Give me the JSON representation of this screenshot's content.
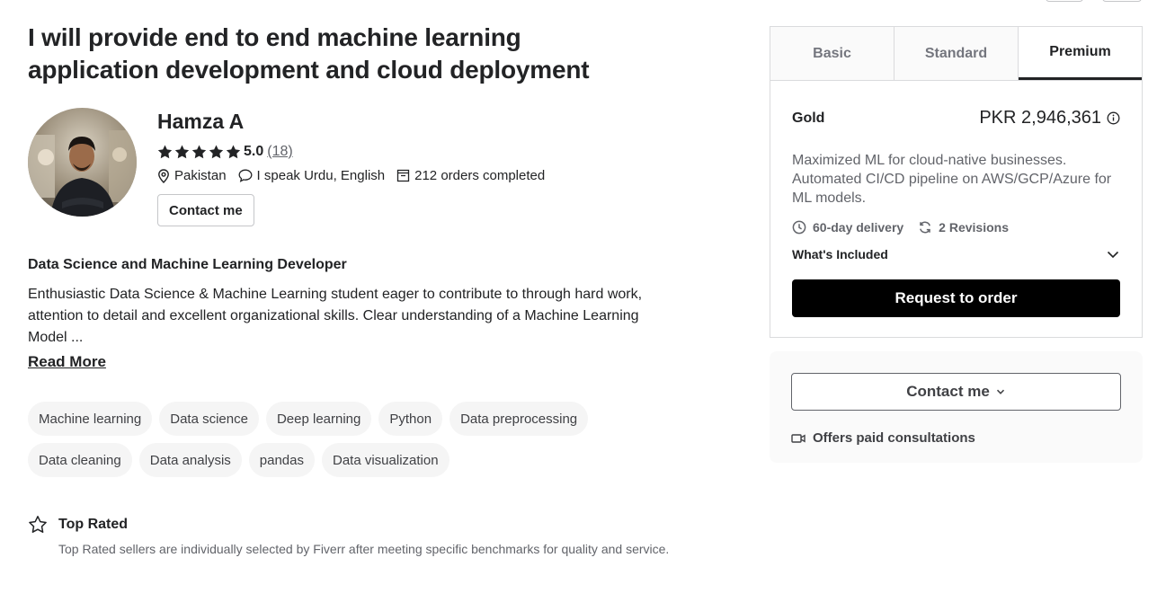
{
  "gig": {
    "title": "I will provide end to end machine learning application development and cloud deployment"
  },
  "seller": {
    "name": "Hamza A",
    "rating": "5.0",
    "reviews": "(18)",
    "stars": 5,
    "country": "Pakistan",
    "languages": "I speak Urdu, English",
    "orders": "212 orders completed",
    "contact_label": "Contact me"
  },
  "about": {
    "heading": "Data Science and Machine Learning Developer",
    "text": "Enthusiastic Data Science & Machine Learning student eager to contribute to through hard work, attention to detail and excellent organizational skills. Clear understanding of a Machine Learning Model ...",
    "read_more": "Read More"
  },
  "tags": [
    "Machine learning",
    "Data science",
    "Deep learning",
    "Python",
    "Data preprocessing",
    "Data cleaning",
    "Data analysis",
    "pandas",
    "Data visualization"
  ],
  "top_rated": {
    "title": "Top Rated",
    "description": "Top Rated sellers are individually selected by Fiverr after meeting specific benchmarks for quality and service."
  },
  "packages": {
    "tabs": [
      "Basic",
      "Standard",
      "Premium"
    ],
    "active_tab": "Premium",
    "name": "Gold",
    "price": "PKR 2,946,361",
    "description": "Maximized ML for cloud-native businesses. Automated CI/CD pipeline on AWS/GCP/Azure for ML models.",
    "delivery": "60-day delivery",
    "revisions": "2 Revisions",
    "included_label": "What's Included",
    "order_label": "Request to order"
  },
  "contact_box": {
    "button_label": "Contact me",
    "consult_label": "Offers paid consultations"
  },
  "colors": {
    "text_dark": "#222325",
    "text_muted": "#62646a",
    "star": "#222325",
    "button_black": "#000000"
  },
  "icons": {
    "location": "map-pin-icon",
    "language": "chat-bubble-icon",
    "orders": "orders-box-icon",
    "top_rated": "star-outline-icon",
    "info": "info-icon",
    "clock": "clock-icon",
    "revisions": "refresh-icon",
    "chevron": "chevron-down-icon",
    "video": "video-camera-icon"
  }
}
